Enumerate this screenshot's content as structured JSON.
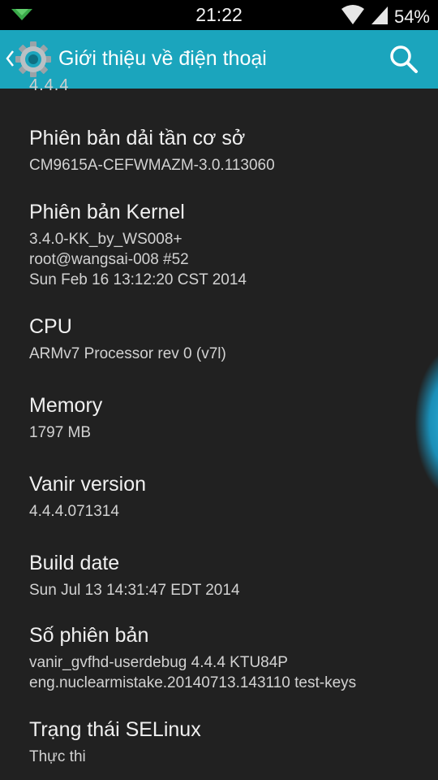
{
  "status_bar": {
    "time": "21:22",
    "battery": "54%",
    "icons": [
      "download-notification-icon",
      "wifi-icon",
      "signal-icon"
    ]
  },
  "action_bar": {
    "title": "Giới thiệu về điện thoại",
    "background": "#1ba5bd",
    "icons": [
      "back-chevron-icon",
      "settings-gear-icon",
      "search-icon"
    ]
  },
  "partial_top_value": "4.4.4",
  "items": [
    {
      "title": "Phiên bản dải tần cơ sở",
      "summary": [
        "CM9615A-CEFWMAZM-3.0.113060"
      ]
    },
    {
      "title": "Phiên bản Kernel",
      "summary": [
        "3.4.0-KK_by_WS008+",
        "root@wangsai-008 #52",
        "Sun Feb 16 13:12:20 CST 2014"
      ]
    },
    {
      "title": "CPU",
      "summary": [
        "ARMv7 Processor rev 0 (v7l)"
      ]
    },
    {
      "title": "Memory",
      "summary": [
        "1797 MB"
      ]
    },
    {
      "title": "Vanir version",
      "summary": [
        "4.4.4.071314"
      ]
    },
    {
      "title": "Build date",
      "summary": [
        "Sun Jul 13 14:31:47 EDT 2014"
      ]
    },
    {
      "title": "Số phiên bản",
      "summary": [
        "vanir_gvfhd-userdebug 4.4.4 KTU84P",
        "eng.nuclearmistake.20140713.143110 test-keys"
      ]
    },
    {
      "title": "Trạng thái SELinux",
      "summary": [
        "Thực thi"
      ]
    }
  ]
}
